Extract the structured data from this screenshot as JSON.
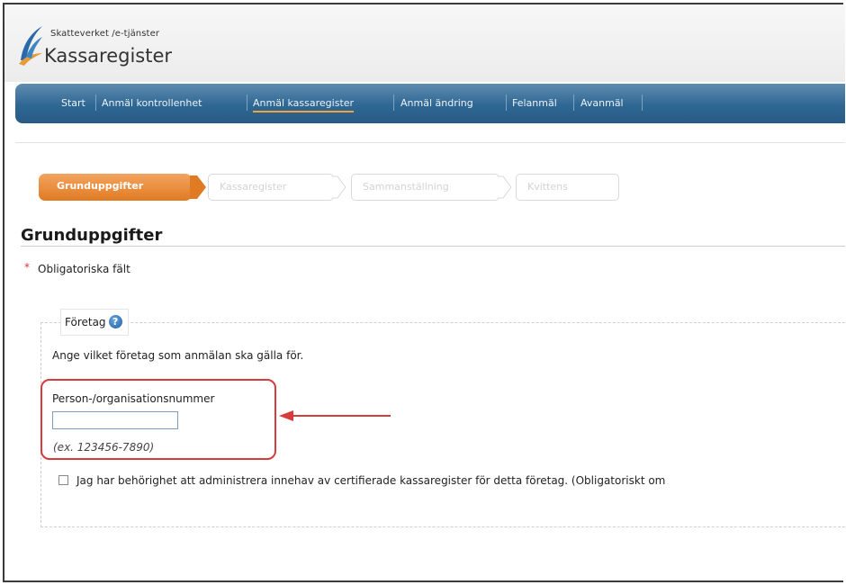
{
  "header": {
    "org_line": "Skatteverket /e-tjänster",
    "app_title": "Kassaregister"
  },
  "nav": {
    "items": [
      {
        "label": "Start"
      },
      {
        "label": "Anmäl kontrollenhet"
      },
      {
        "label": "Anmäl kassaregister",
        "active": true
      },
      {
        "label": "Anmäl ändring"
      },
      {
        "label": "Felanmäl"
      },
      {
        "label": "Avanmäl"
      }
    ]
  },
  "steps": [
    {
      "label": "Grunduppgifter",
      "active": true
    },
    {
      "label": "Kassaregister"
    },
    {
      "label": "Sammanställning"
    },
    {
      "label": "Kvittens"
    }
  ],
  "page": {
    "heading": "Grunduppgifter",
    "required_marker": "*",
    "required_note": "Obligatoriska fält"
  },
  "section": {
    "legend": "Företag",
    "help_icon": "help-icon",
    "description": "Ange vilket företag som anmälan ska gälla för.",
    "field_label": "Person-/organisationsnummer",
    "field_value": "",
    "field_hint": "(ex. 123456-7890)",
    "checkbox_label": "Jag har behörighet att administrera innehav av certifierade kassaregister för detta företag. (Obligatoriskt om"
  },
  "colors": {
    "nav_blue": "#2f6793",
    "active_step_orange": "#e07b23",
    "highlight_red": "#d63c3c",
    "help_blue": "#1f5fa6"
  }
}
